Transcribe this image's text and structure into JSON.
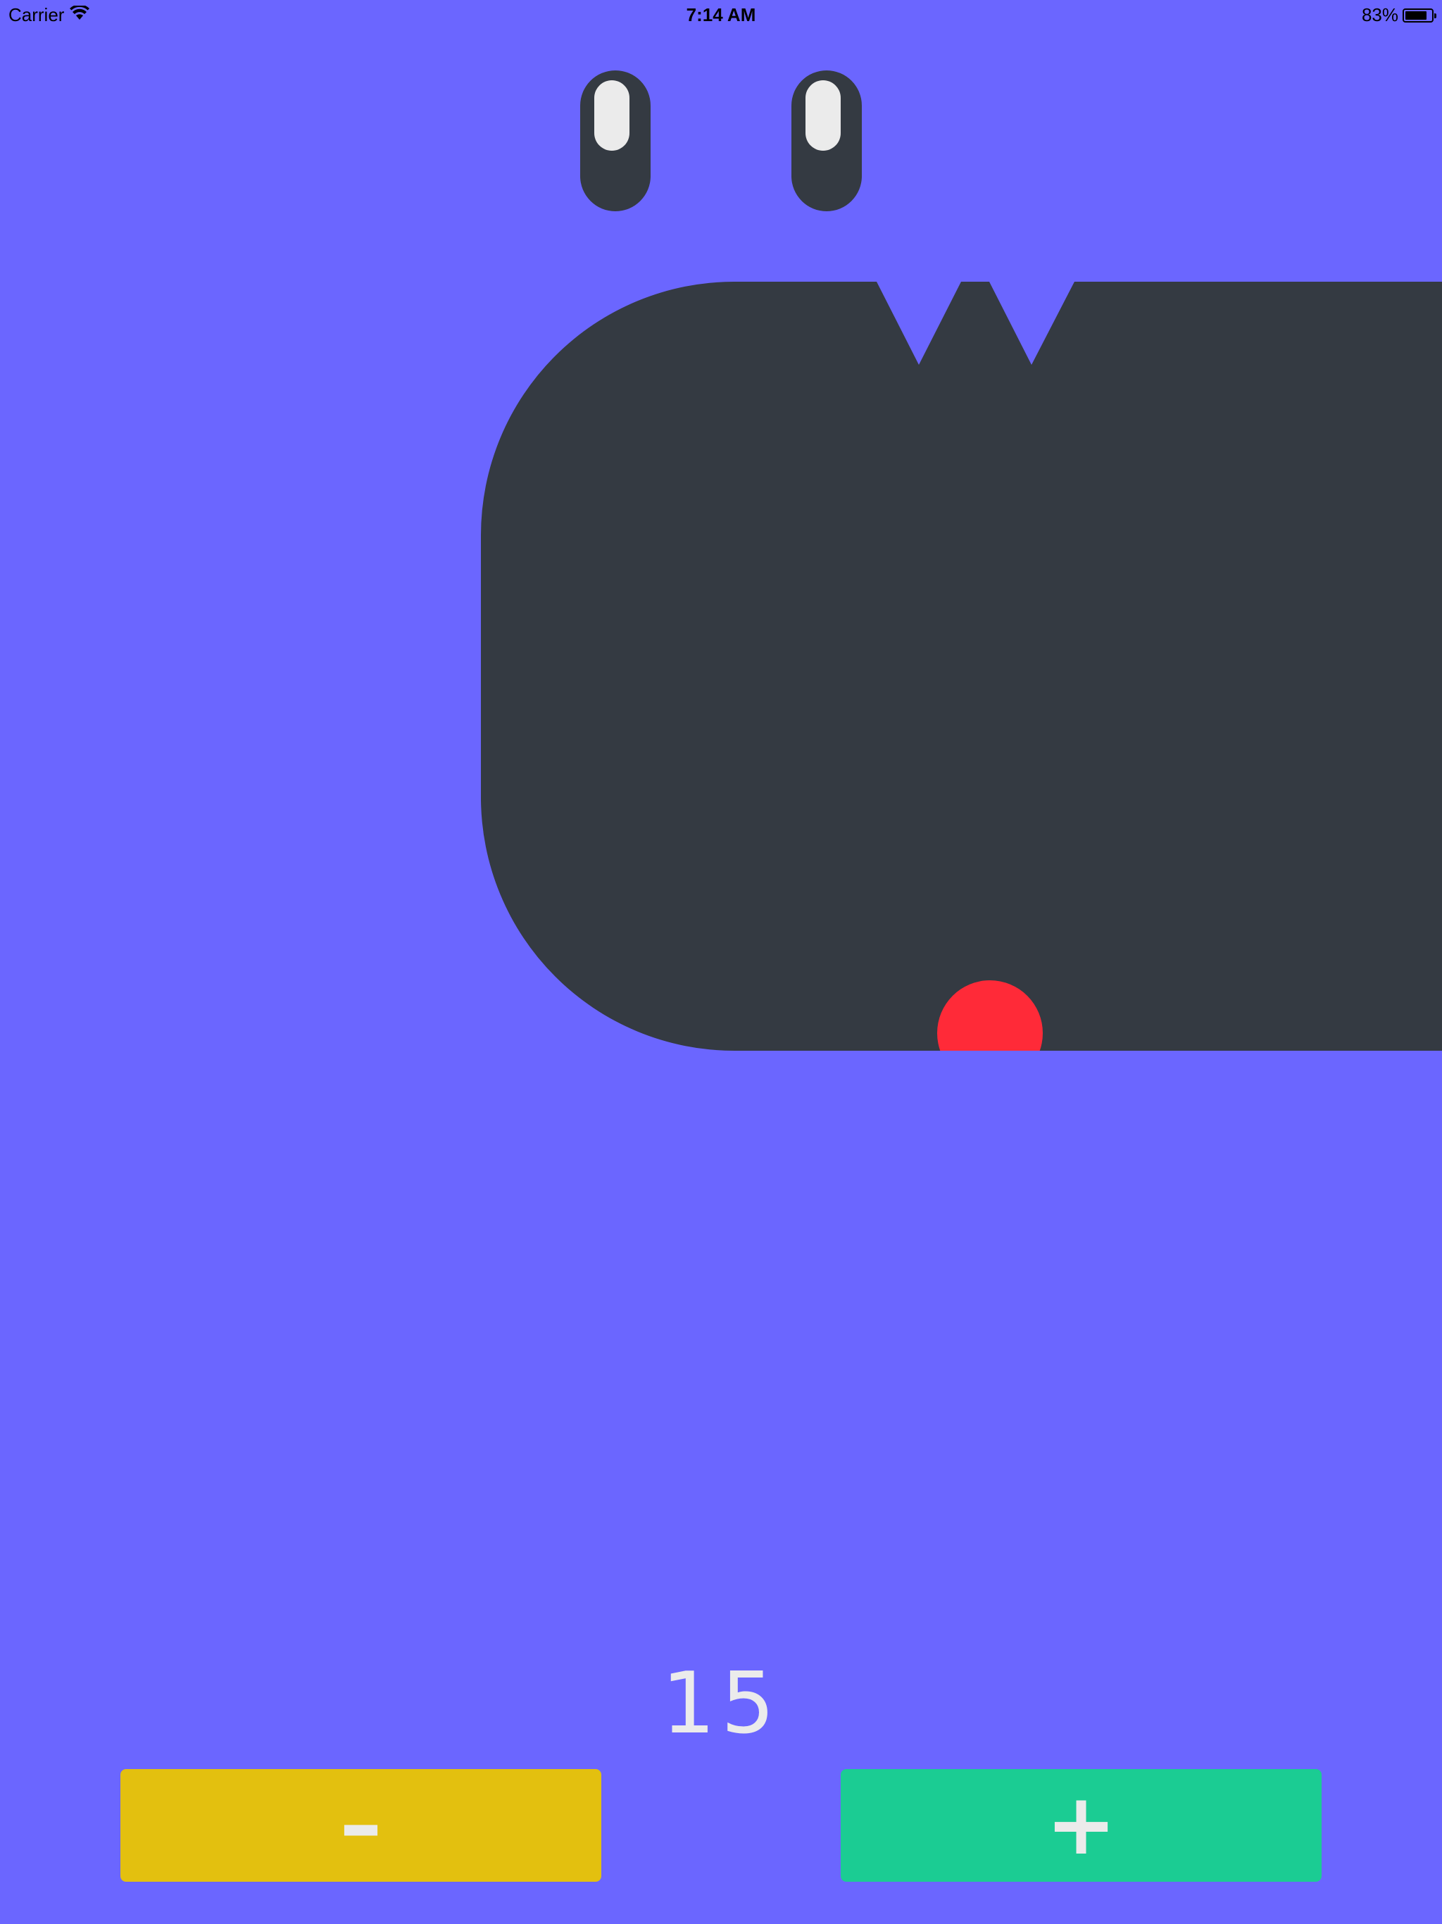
{
  "status_bar": {
    "carrier": "Carrier",
    "time": "7:14 AM",
    "battery_percent": "83%",
    "battery_level": 0.83,
    "icons": [
      "wifi-icon",
      "battery-icon"
    ]
  },
  "counter": {
    "value": "15"
  },
  "buttons": {
    "decrement_label": "–",
    "increment_label": "+"
  },
  "colors": {
    "background": "#6B66FF",
    "face_dark": "#343A42",
    "eye_highlight": "#EBEBEB",
    "tongue": "#FF2A38",
    "counter_text": "#EBEBEB",
    "decrement_button": "#E3C00F",
    "increment_button": "#1BCC93"
  }
}
